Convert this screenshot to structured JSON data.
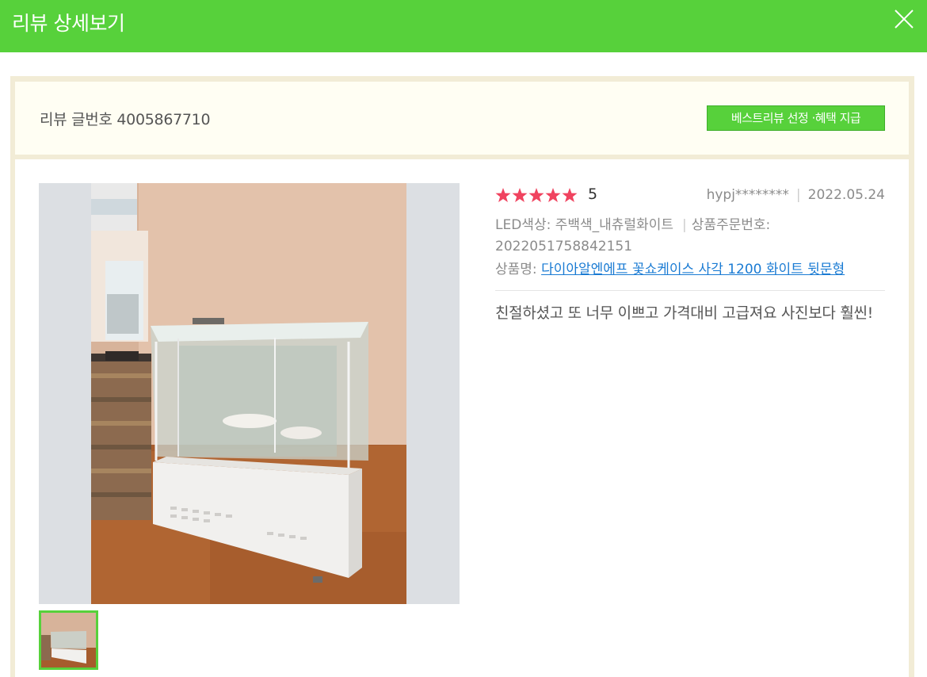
{
  "header": {
    "title": "리뷰 상세보기",
    "close_icon": "close-icon"
  },
  "notice": {
    "review_number": "리뷰 글번호 4005867710",
    "best_review_button": "베스트리뷰 선정 ·혜택 지급"
  },
  "review": {
    "rating": 5,
    "score_label": "5",
    "user": "hypj********",
    "date": "2022.05.24",
    "option": "LED색상: 주백색_내츄럴화이트",
    "order_label": "상품주문번호:",
    "order_number": "2022051758842151",
    "product_label": "상품명:",
    "product_name": "다이아알엔에프 꽃쇼케이스 사각 1200 화이트 뒷문형",
    "text": "친절하셨고 또 너무 이쁘고 가격대비 고급져요 사진보다 훨씬!"
  },
  "colors": {
    "accent": "#57d13b",
    "star": "#f0435f",
    "link": "#1a7bd3",
    "notice_bg": "#fffef3",
    "border": "#f2ecd6"
  },
  "icons": {
    "star": "star-icon",
    "close": "close-icon"
  }
}
